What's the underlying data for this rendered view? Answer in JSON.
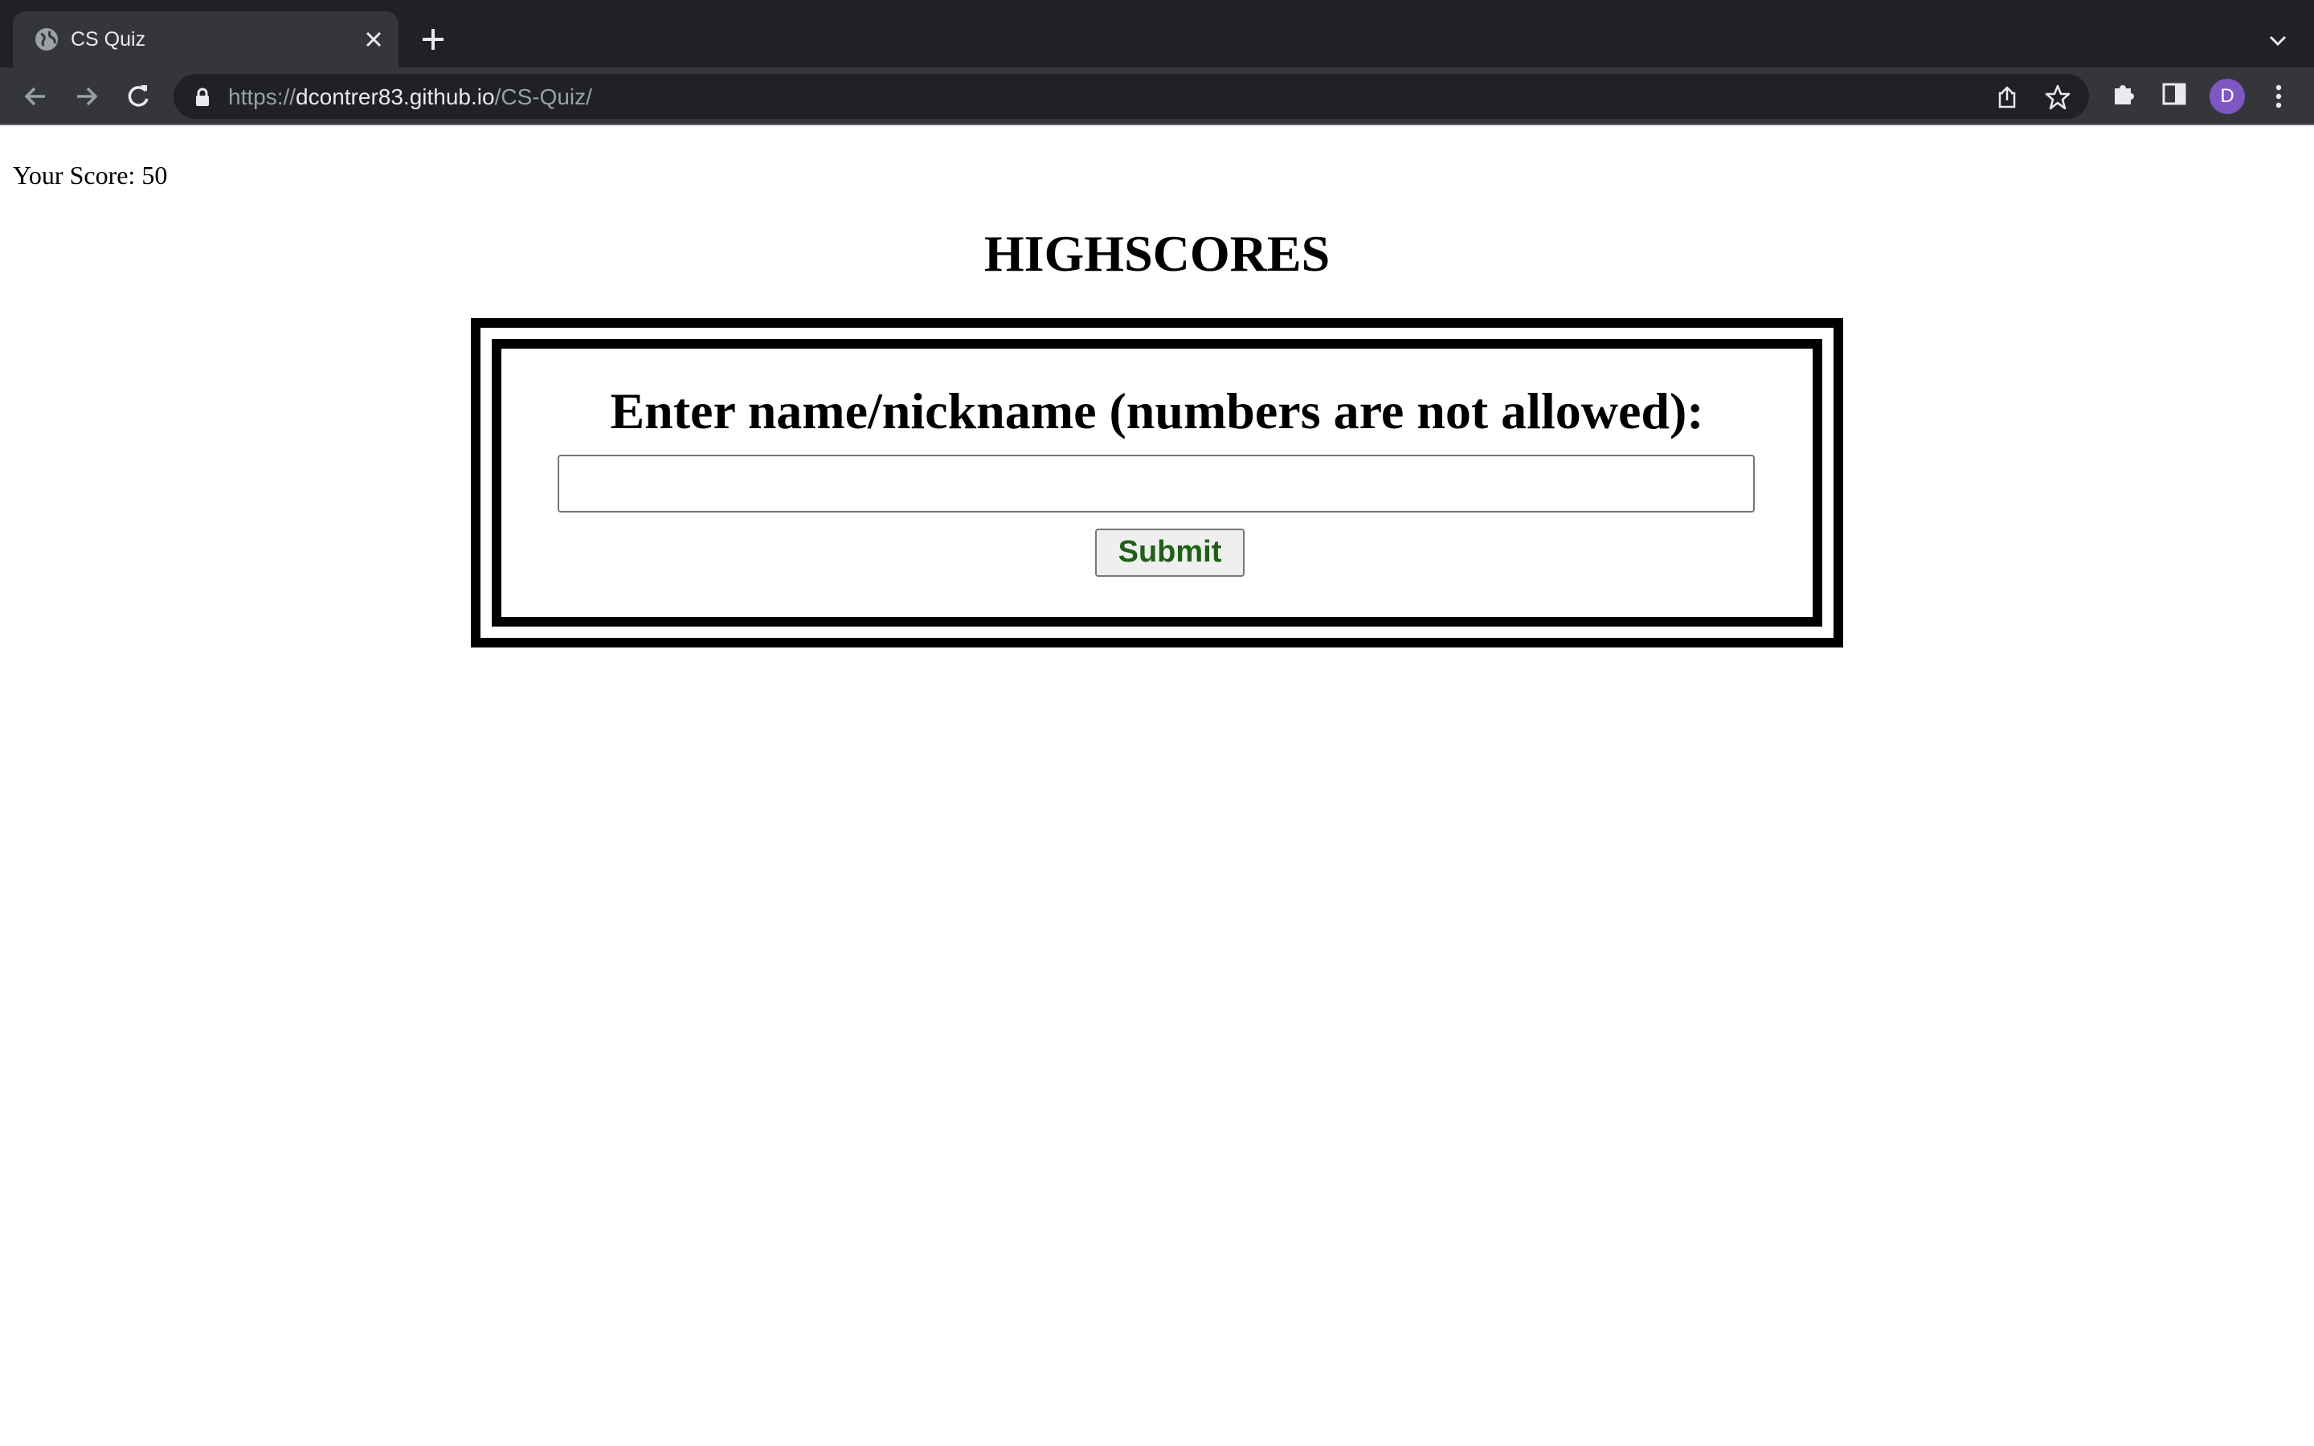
{
  "browser": {
    "tab": {
      "title": "CS Quiz"
    },
    "url": {
      "scheme": "https://",
      "host": "dcontrer83.github.io",
      "path": "/CS-Quiz/"
    },
    "profile_initial": "D",
    "icons": [
      "globe-icon",
      "close-icon",
      "plus-icon",
      "chevron-down-icon",
      "back-arrow-icon",
      "forward-arrow-icon",
      "reload-icon",
      "lock-icon",
      "share-icon",
      "star-icon",
      "puzzle-icon",
      "side-panel-icon",
      "kebab-menu-icon"
    ]
  },
  "page": {
    "score_text": "Your Score: 50",
    "title": "HIGHSCORES",
    "form": {
      "prompt": "Enter name/nickname (numbers are not allowed):",
      "input_value": "",
      "submit_label": "Submit"
    }
  },
  "colors": {
    "chrome_dark": "#202124",
    "chrome_tab": "#35363a",
    "avatar": "#7e57c2",
    "submit_text": "#1f5f16"
  }
}
